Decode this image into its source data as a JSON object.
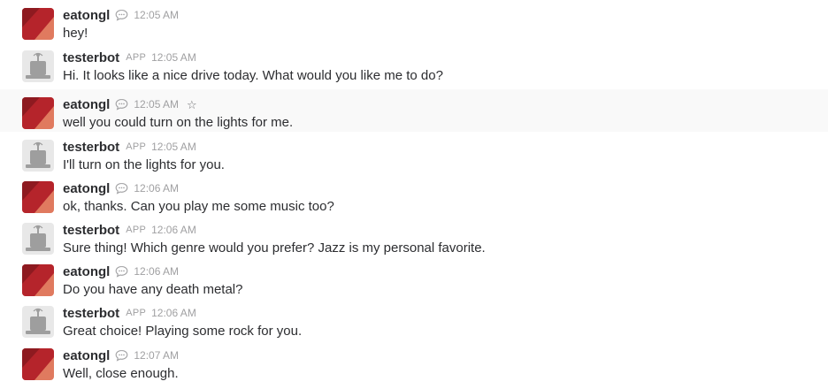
{
  "colors": {
    "user_avatar_primary": "#b5242b",
    "user_avatar_secondary": "#e07a5f",
    "bot_avatar": "#9e9e9e",
    "timestamp": "#a0a0a2",
    "hover_background": "#f9f9f9"
  },
  "messages": [
    {
      "sender": "eatongl",
      "type": "user",
      "time": "12:05 AM",
      "text": "hey!"
    },
    {
      "sender": "testerbot",
      "type": "bot",
      "badge": "APP",
      "time": "12:05 AM",
      "text": "Hi. It looks like a nice drive today. What would you like me to do?"
    },
    {
      "sender": "eatongl",
      "type": "user",
      "time": "12:05 AM",
      "text": "well you could turn on the lights for me.",
      "hover": true,
      "star_icon": "star-outline-icon"
    },
    {
      "sender": "testerbot",
      "type": "bot",
      "badge": "APP",
      "time": "12:05 AM",
      "text": "I'll turn on the lights for you."
    },
    {
      "sender": "eatongl",
      "type": "user",
      "time": "12:06 AM",
      "text": "ok, thanks. Can you play me some music too?"
    },
    {
      "sender": "testerbot",
      "type": "bot",
      "badge": "APP",
      "time": "12:06 AM",
      "text": "Sure thing! Which genre would you prefer? Jazz is my personal favorite."
    },
    {
      "sender": "eatongl",
      "type": "user",
      "time": "12:06 AM",
      "text": "Do you have any death metal?"
    },
    {
      "sender": "testerbot",
      "type": "bot",
      "badge": "APP",
      "time": "12:06 AM",
      "text": "Great choice! Playing some rock for you."
    },
    {
      "sender": "eatongl",
      "type": "user",
      "time": "12:07 AM",
      "text": "Well, close enough."
    }
  ]
}
